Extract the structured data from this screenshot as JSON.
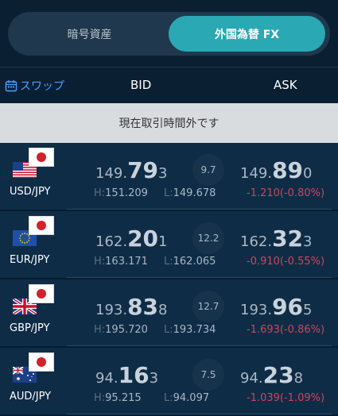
{
  "tabs": [
    {
      "label": "暗号資産"
    },
    {
      "label": "外国為替 FX"
    }
  ],
  "header": {
    "swap_label": "スワップ",
    "bid_label": "BID",
    "ask_label": "ASK"
  },
  "banner": "現在取引時間外です",
  "pairs": [
    {
      "name": "USD/JPY",
      "base_flag": "us-flag-icon",
      "bid": {
        "a": "149.",
        "b": "79",
        "c": "3"
      },
      "spread": "9.7",
      "ask": {
        "a": "149.",
        "b": "89",
        "c": "0"
      },
      "high_label": "H:",
      "high": "151.209",
      "low_label": "L:",
      "low": "149.678",
      "change": "-1.210(-0.80%)"
    },
    {
      "name": "EUR/JPY",
      "base_flag": "eu-flag-icon",
      "bid": {
        "a": "162.",
        "b": "20",
        "c": "1"
      },
      "spread": "12.2",
      "ask": {
        "a": "162.",
        "b": "32",
        "c": "3"
      },
      "high_label": "H:",
      "high": "163.171",
      "low_label": "L:",
      "low": "162.065",
      "change": "-0.910(-0.55%)"
    },
    {
      "name": "GBP/JPY",
      "base_flag": "uk-flag-icon",
      "bid": {
        "a": "193.",
        "b": "83",
        "c": "8"
      },
      "spread": "12.7",
      "ask": {
        "a": "193.",
        "b": "96",
        "c": "5"
      },
      "high_label": "H:",
      "high": "195.720",
      "low_label": "L:",
      "low": "193.734",
      "change": "-1.693(-0.86%)"
    },
    {
      "name": "AUD/JPY",
      "base_flag": "au-flag-icon",
      "bid": {
        "a": "94.",
        "b": "16",
        "c": "3"
      },
      "spread": "7.5",
      "ask": {
        "a": "94.",
        "b": "23",
        "c": "8"
      },
      "high_label": "H:",
      "high": "95.215",
      "low_label": "L:",
      "low": "94.097",
      "change": "-1.039(-1.09%)"
    }
  ],
  "colors": {
    "accent": "#2aa8b3",
    "link": "#4aa0ff",
    "negative": "#d0455a",
    "background": "#0f2c47"
  }
}
